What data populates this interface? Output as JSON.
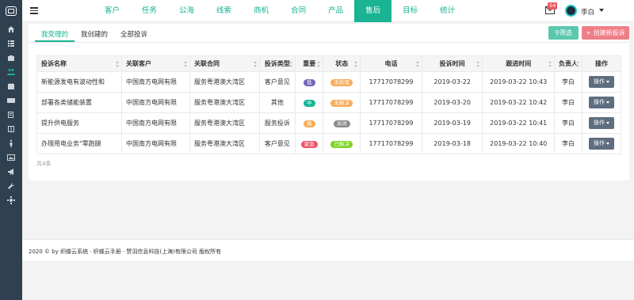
{
  "sidebar": {
    "items": [
      {
        "icon": "home-icon",
        "active": false
      },
      {
        "icon": "list-icon",
        "active": false
      },
      {
        "icon": "briefcase-icon",
        "active": false
      },
      {
        "icon": "users-icon",
        "active": true
      },
      {
        "icon": "calendar-icon",
        "active": false
      },
      {
        "icon": "card-icon",
        "active": false
      },
      {
        "icon": "book-icon",
        "active": false
      },
      {
        "icon": "columns-icon",
        "active": false
      },
      {
        "icon": "person-icon",
        "active": false
      },
      {
        "icon": "image-icon",
        "active": false
      },
      {
        "icon": "megaphone-icon",
        "active": false
      },
      {
        "icon": "wrench-icon",
        "active": false
      },
      {
        "icon": "settings-icon",
        "active": false
      }
    ]
  },
  "topnav": {
    "items": [
      "客户",
      "任务",
      "公海",
      "线索",
      "商机",
      "合同",
      "产品",
      "售后",
      "目标",
      "统计"
    ],
    "active_index": 7
  },
  "header": {
    "mail_count": "54",
    "username": "李白"
  },
  "tabs": [
    "我受理的",
    "我创建的",
    "全部投诉"
  ],
  "actions": {
    "filter": "筛选",
    "create": "创建新投诉"
  },
  "table": {
    "columns": [
      "投诉名称",
      "关联客户",
      "关联合同",
      "投诉类型",
      "重要",
      "状态",
      "电话",
      "投诉时间",
      "跟进时间",
      "负责人",
      "操作"
    ],
    "rows": [
      {
        "name": "新能源发电有波动性和",
        "customer": "中国南方电网有限",
        "contract": "服务粤港澳大湾区",
        "type": "客户意见",
        "priority": "低",
        "priority_color": "#7266ba",
        "status": "未处理",
        "status_color": "#f8ac59",
        "phone": "17717078299",
        "complaint_date": "2019-03-22",
        "follow_time": "2019-03-22 10:43",
        "owner": "李白",
        "op": "操作"
      },
      {
        "name": "部署各类储能装置",
        "customer": "中国南方电网有限",
        "contract": "服务粤港澳大湾区",
        "type": "其他",
        "priority": "中",
        "priority_color": "#1ab394",
        "status": "未解决",
        "status_color": "#f8ac59",
        "phone": "17717078299",
        "complaint_date": "2019-03-20",
        "follow_time": "2019-03-22 10:42",
        "owner": "李白",
        "op": "操作"
      },
      {
        "name": "提升供电服务",
        "customer": "中国南方电网有限",
        "contract": "服务粤港澳大湾区",
        "type": "服务投诉",
        "priority": "高",
        "priority_color": "#f8ac59",
        "status": "关闭",
        "status_color": "#8a8a8a",
        "phone": "17717078299",
        "complaint_date": "2019-03-19",
        "follow_time": "2019-03-22 10:41",
        "owner": "李白",
        "op": "操作"
      },
      {
        "name": "办理用电业务\"零跑腿",
        "customer": "中国南方电网有限",
        "contract": "服务粤港澳大湾区",
        "type": "客户意见",
        "priority": "紧急",
        "priority_color": "#ed5565",
        "status": "已解决",
        "status_color": "#7ed321",
        "phone": "17717078299",
        "complaint_date": "2019-03-18",
        "follow_time": "2019-03-22 10:40",
        "owner": "李白",
        "op": "操作"
      }
    ],
    "total_text": "共4条"
  },
  "footer": {
    "text": "2020 © by 织蝶云系统 · 织蝶云手册 · 赞羽信息科技(上海)有限公司 版权所有"
  }
}
